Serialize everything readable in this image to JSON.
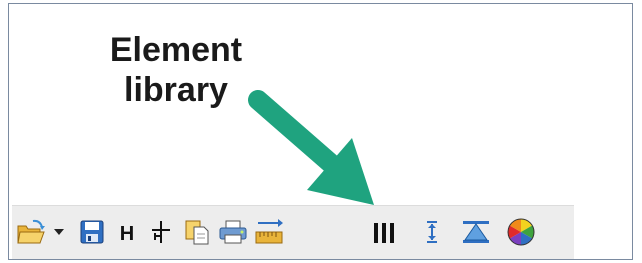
{
  "callout": {
    "line1": "Element",
    "line2": "library",
    "arrow_color": "#1fa37f"
  },
  "toolbar": {
    "buttons": [
      {
        "name": "open-folder-icon"
      },
      {
        "name": "dropdown-arrow-icon"
      },
      {
        "name": "save-icon"
      },
      {
        "name": "h-icon",
        "glyph": "H"
      },
      {
        "name": "crosshair-icon"
      },
      {
        "name": "paste-copy-icon"
      },
      {
        "name": "print-icon"
      },
      {
        "name": "ruler-icon"
      },
      {
        "name": "element-library-icon"
      },
      {
        "name": "vertical-spacing-icon"
      },
      {
        "name": "triangle-section-icon"
      },
      {
        "name": "color-wheel-icon"
      }
    ]
  }
}
